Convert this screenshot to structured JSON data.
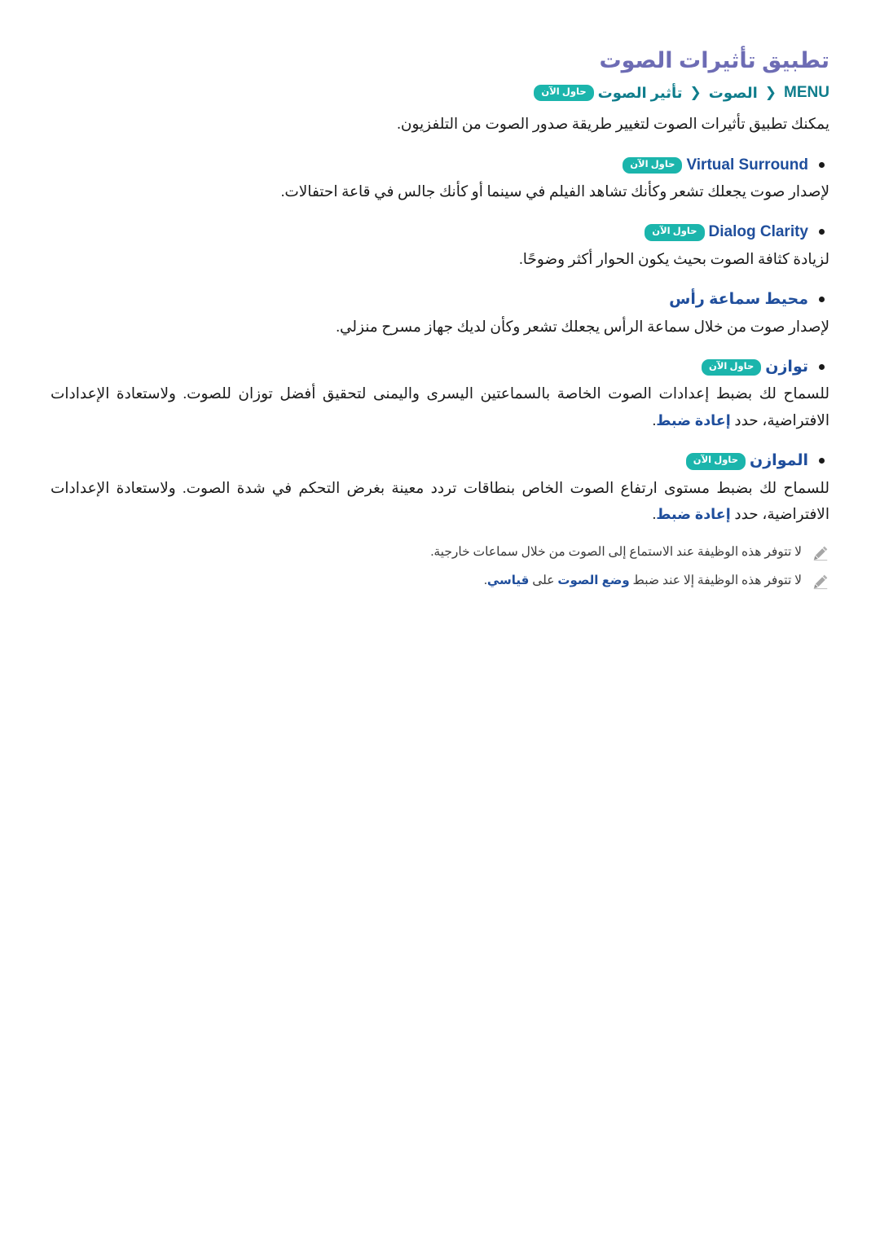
{
  "document": {
    "title": "تطبيق تأثيرات الصوت",
    "badge_label": "حاول الآن",
    "colors": {
      "title": "#6d6cb4",
      "breadcrumb": "#0f7d8c",
      "heading": "#1f4e9c",
      "badge_bg": "#1bb5ac",
      "body": "#1a1a1a",
      "note": "#3a3a3a",
      "pencil": "#9a9a9a"
    }
  },
  "breadcrumb": {
    "menu_label": "MENU",
    "separator": "❮",
    "items": [
      {
        "label": "الصوت"
      },
      {
        "label": "تأثير الصوت"
      }
    ],
    "badge": "حاول الآن"
  },
  "intro": {
    "text": "يمكنك تطبيق تأثيرات الصوت لتغيير طريقة صدور الصوت من التلفزيون."
  },
  "bullets": [
    {
      "label": "Virtual Surround",
      "direction": "ltr",
      "has_badge": true,
      "badge": "حاول الآن",
      "description": "لإصدار صوت يجعلك تشعر وكأنك تشاهد الفيلم في سينما أو كأنك جالس في قاعة احتفالات."
    },
    {
      "label": "Dialog Clarity",
      "direction": "ltr",
      "has_badge": true,
      "badge": "حاول الآن",
      "description": "لزيادة كثافة الصوت بحيث يكون الحوار أكثر وضوحًا."
    },
    {
      "label": "محيط سماعة رأس",
      "direction": "rtl",
      "has_badge": false,
      "badge": "",
      "description": "لإصدار صوت من خلال سماعة الرأس يجعلك تشعر وكأن لديك جهاز مسرح منزلي."
    },
    {
      "label": "توازن",
      "direction": "rtl",
      "has_badge": true,
      "badge": "حاول الآن",
      "description_part1": "للسماح لك بضبط إعدادات الصوت الخاصة بالسماعتين اليسرى واليمنى لتحقيق أفضل توزان للصوت. ولاستعادة الإعدادات الافتراضية، حدد ",
      "description_term": "إعادة ضبط",
      "description_part2": "."
    },
    {
      "label": "الموازن",
      "direction": "rtl",
      "has_badge": true,
      "badge": "حاول الآن",
      "description_part1": "للسماح لك بضبط مستوى ارتفاع الصوت الخاص بنطاقات تردد معينة بغرض التحكم في شدة الصوت. ولاستعادة الإعدادات الافتراضية، حدد ",
      "description_term": "إعادة ضبط",
      "description_part2": "."
    }
  ],
  "notes": [
    {
      "icon": "pencil-icon",
      "text": "لا تتوفر هذه الوظيفة عند الاستماع إلى الصوت من خلال سماعات خارجية."
    },
    {
      "icon": "pencil-icon",
      "part1": "لا تتوفر هذه الوظيفة إلا عند ضبط ",
      "term1": "وضع الصوت",
      "part2": " على ",
      "term2": "قياسي",
      "part3": "."
    }
  ]
}
